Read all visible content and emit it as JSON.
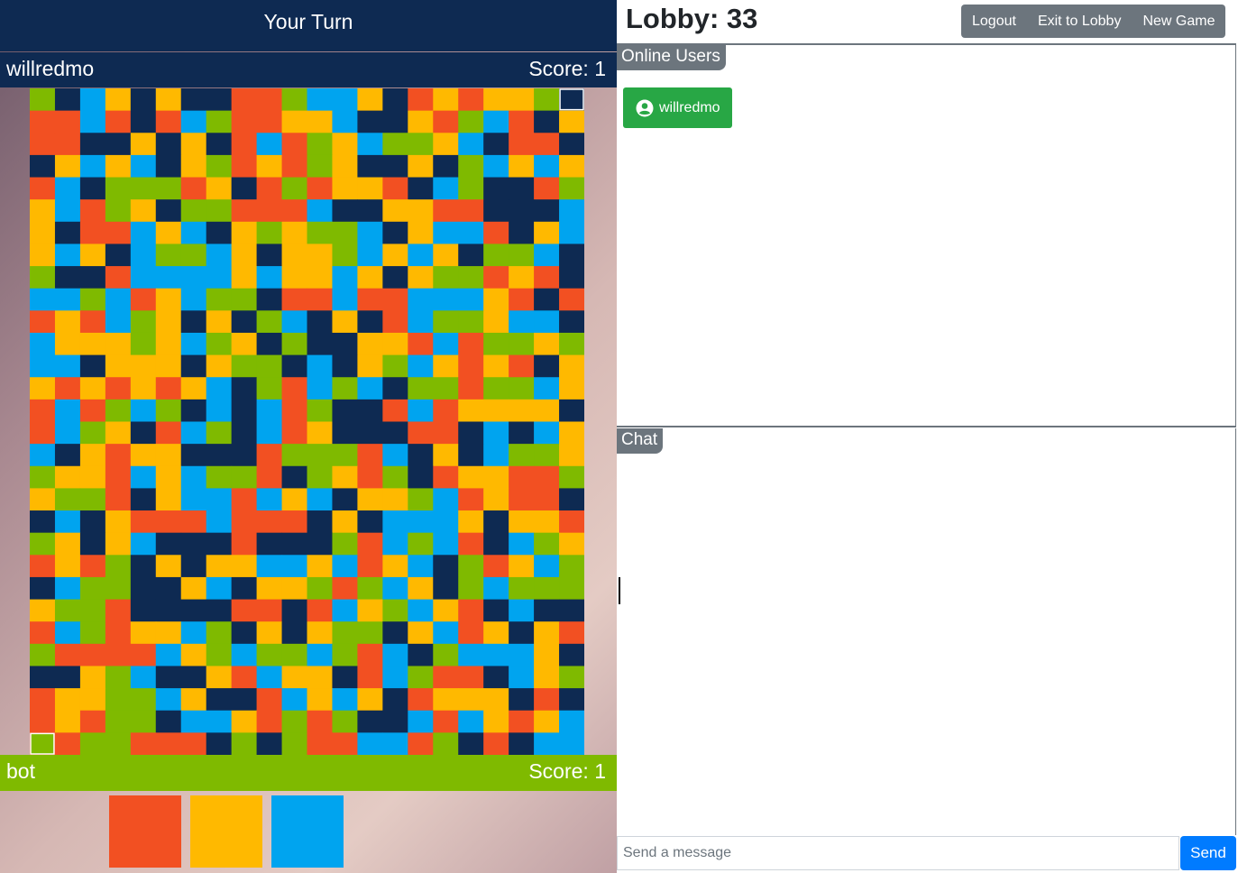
{
  "game": {
    "turn_label": "Your Turn",
    "top_player": {
      "name": "willredmo",
      "score_label": "Score: 1",
      "color": "#0e2a52"
    },
    "bottom_player": {
      "name": "bot",
      "score_label": "Score: 1",
      "color": "#7fba00"
    },
    "colors": {
      "N": "#0e2a52",
      "G": "#7fba00",
      "B": "#00a4ef",
      "Y": "#ffb900",
      "O": "#f25022"
    },
    "board_rows": [
      "GNBYNYNNOOGBBYNOYOYYGN",
      "OOBONOBGOOYYBNNYOGBONY",
      "OONNYNYNOBOGYBGGYBNOON",
      "NYBYBNYGOYOGYNNYNGBYBY",
      "OBNGGGOYNOGOYYONBGNNOG",
      "YBOGYNGGOOOBNNYYOONNNB",
      "YNOOBYBNYGYGGBNYBBONYB",
      "YBYNBGGBYNYYGBYBYNGGBN",
      "GNNOBBBBYBYYBYNYGGOYON",
      "BBGBOYBGGNOOBOOBBBYONO",
      "OYOBGYNYNGBNYNOBGGYBBN",
      "BYYYGYBGYNGNNYYOBOGGYG",
      "BBNYYYNYGGNBNYGBYOYONY",
      "YOYOYOYBNGOBGBNGGOGGBY",
      "OBOGBGNBNBOGNNOBOYYYYN",
      "OBGYNOBGNBOYNNNOONBNBY",
      "BNYOYYNNNOGGGOBNYNBGGY",
      "GYYOBYBGGONGYOGNOYYOOG",
      "YGGONYBBOBYBNYYGBOYOON",
      "NBNYOOOBOOONYNBBBYNYYO",
      "GYNYBNNNONNNGOBGBONBGY",
      "OYOGNYNYYBBYBOYBNGOYBG",
      "NBGGNNYBNYYGOGBYNGBGGG",
      "YGGONNNNOONOBYGBYONBNN",
      "OBGOYYBGNYNYGGNYBOYNYO",
      "GOOOOBYGBGGBGOBNGBBBYN",
      "NNYGBNNYOBYYNOBGOONBYG",
      "OYYGGBYNNOBYBYNOYYYNON",
      "OYOGGNBBYOGOGNNBOBYOYB",
      "OOGGOOONGNGOOBBOGNONBBG"
    ],
    "top_corner_marker": "top-right",
    "bottom_corner_marker": "bottom-left",
    "color_choices": [
      {
        "name": "orange",
        "color": "#f25022"
      },
      {
        "name": "yellow",
        "color": "#ffb900"
      },
      {
        "name": "blue",
        "color": "#00a4ef"
      }
    ]
  },
  "lobby": {
    "title": "Lobby: 33",
    "buttons": {
      "logout": "Logout",
      "exit": "Exit to Lobby",
      "new_game": "New Game"
    },
    "online_label": "Online Users",
    "users": [
      {
        "name": "willredmo"
      }
    ],
    "chat_label": "Chat",
    "input_placeholder": "Send a message",
    "send_label": "Send"
  }
}
